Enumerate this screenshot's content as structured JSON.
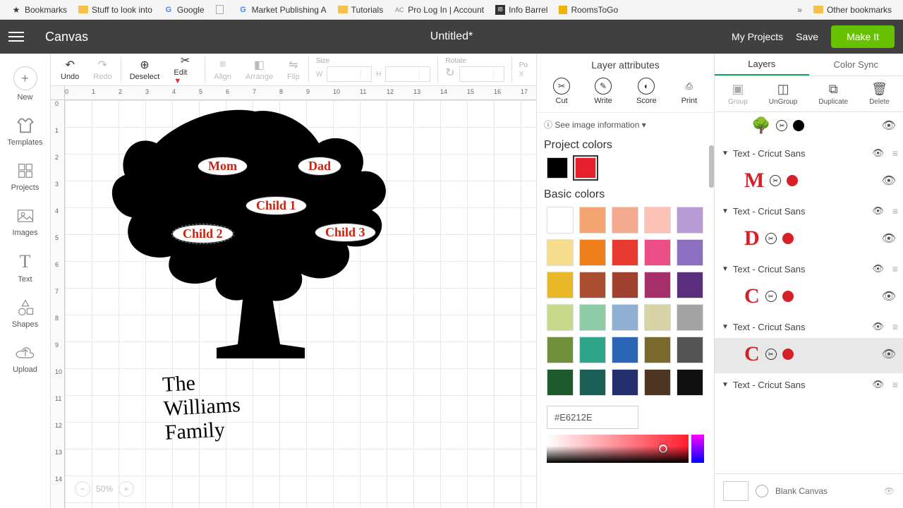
{
  "bookmarks": {
    "items": [
      "Bookmarks",
      "Stuff to look into",
      "Google",
      "",
      "Market Publishing A",
      "Tutorials",
      "Pro Log In | Account",
      "Info Barrel",
      "RoomsToGo"
    ],
    "overflow": "»",
    "other": "Other bookmarks"
  },
  "header": {
    "app": "Canvas",
    "doc": "Untitled*",
    "my_projects": "My Projects",
    "save": "Save",
    "make_it": "Make It"
  },
  "left_tools": [
    "New",
    "Templates",
    "Projects",
    "Images",
    "Text",
    "Shapes",
    "Upload"
  ],
  "toolbar": {
    "undo": "Undo",
    "redo": "Redo",
    "deselect": "Deselect",
    "edit": "Edit",
    "align": "Align",
    "arrange": "Arrange",
    "flip": "Flip",
    "size": "Size",
    "w": "W",
    "h": "H",
    "rotate": "Rotate",
    "position": "Po",
    "x": "X"
  },
  "rulers": {
    "h": [
      "0",
      "1",
      "2",
      "3",
      "4",
      "5",
      "6",
      "7",
      "8",
      "9",
      "10",
      "11",
      "12",
      "13",
      "14",
      "15",
      "16",
      "17"
    ],
    "v": [
      "0",
      "1",
      "2",
      "3",
      "4",
      "5",
      "6",
      "7",
      "8",
      "9",
      "10",
      "11",
      "12",
      "13",
      "14"
    ]
  },
  "art": {
    "mom": "Mom",
    "dad": "Dad",
    "child1": "Child 1",
    "child2": "Child 2",
    "child3": "Child 3",
    "family": "The Williams Family"
  },
  "zoom": "50%",
  "attr": {
    "title": "Layer attributes",
    "cut": "Cut",
    "write": "Write",
    "score": "Score",
    "print": "Print",
    "see_info": "ⓘ See image information ▾",
    "project_colors": "Project colors",
    "basic_colors": "Basic colors",
    "hex": "#E6212E",
    "project_swatches": [
      "#000000",
      "#e6212e"
    ],
    "basic_swatches": [
      "#ffffff",
      "#f4a56f",
      "#f5a98e",
      "#fbc2b5",
      "#b79ad6",
      "#f6dd8d",
      "#ef7f1a",
      "#e93a32",
      "#ec4f87",
      "#8b6fc0",
      "#e9b828",
      "#a94e31",
      "#a0422f",
      "#a6306a",
      "#5b2e7d",
      "#c9d98b",
      "#8ecba7",
      "#8fb0d0",
      "#d8d3a6",
      "#a3a3a3",
      "#6f8f3a",
      "#2fa486",
      "#2a66b5",
      "#7a6a2d",
      "#555555",
      "#1d5a2b",
      "#1a5f55",
      "#24306d",
      "#4d3521",
      "#111111"
    ]
  },
  "layers": {
    "tab_layers": "Layers",
    "tab_color_sync": "Color Sync",
    "ops": {
      "group": "Group",
      "ungroup": "UnGroup",
      "duplicate": "Duplicate",
      "delete": "Delete"
    },
    "label": "Text - Cricut Sans",
    "letters": [
      "M",
      "D",
      "C",
      "C"
    ],
    "blank": "Blank Canvas"
  }
}
